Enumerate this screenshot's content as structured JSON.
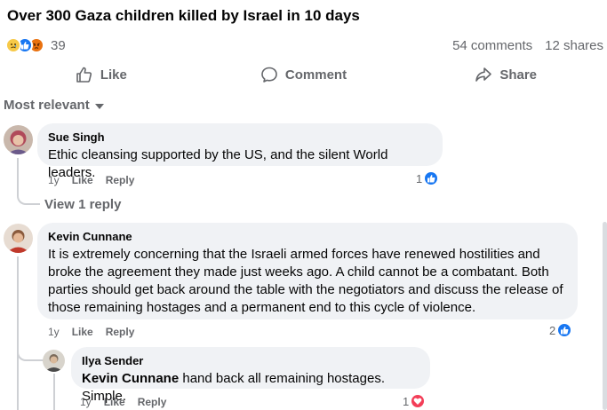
{
  "post": {
    "title": "Over 300 Gaza children killed by Israel in 10 days",
    "reaction_count": "39",
    "comments": "54 comments",
    "shares": "12 shares"
  },
  "actions": {
    "like": "Like",
    "comment": "Comment",
    "share": "Share"
  },
  "sort": {
    "label": "Most relevant"
  },
  "comments": [
    {
      "author": "Sue Singh",
      "text": "Ethic cleansing supported by the US, and the silent World leaders.",
      "time": "1y",
      "like": "Like",
      "reply": "Reply",
      "reaction_count": "1",
      "view_replies": "View 1 reply"
    },
    {
      "author": "Kevin Cunnane",
      "text": "It is extremely concerning that the Israeli armed forces have renewed hostilities and broke the agreement they made just weeks ago. A child cannot be a combatant. Both parties should get back around the table with the negotiators and discuss the release of those remaining hostages and a permanent end to this cycle of violence.",
      "time": "1y",
      "like": "Like",
      "reply": "Reply",
      "reaction_count": "2"
    }
  ],
  "reply": {
    "author": "Ilya Sender",
    "mention": "Kevin Cunnane",
    "text": " hand back all remaining hostages. Simple.",
    "time": "1y",
    "like": "Like",
    "reply": "Reply",
    "reaction_count": "1"
  },
  "colors": {
    "accent": "#1877f2",
    "muted_text": "#65676b",
    "bubble": "#f0f2f5",
    "heart": "#f33e58"
  }
}
